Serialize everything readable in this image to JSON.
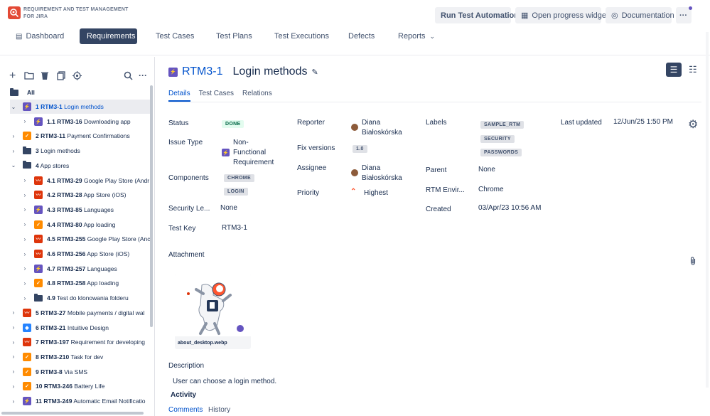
{
  "header": {
    "app_title": "REQUIREMENT AND TEST MANAGEMENT FOR JIRA",
    "run_automation": "Run Test Automation",
    "progress_widget": "Open progress widget",
    "documentation": "Documentation",
    "more": "···"
  },
  "nav": {
    "dashboard": "Dashboard",
    "requirements": "Requirements",
    "test_cases": "Test Cases",
    "test_plans": "Test Plans",
    "test_executions": "Test Executions",
    "defects": "Defects",
    "reports": "Reports"
  },
  "tree": {
    "all": "All",
    "rows": [
      {
        "num": "1",
        "key": "RTM3-1",
        "title": "Login methods",
        "type": "story"
      },
      {
        "num": "1.1",
        "key": "RTM3-16",
        "title": "Downloading app",
        "type": "story"
      },
      {
        "num": "2",
        "key": "RTM3-11",
        "title": "Payment Confirmations",
        "type": "task-orange"
      },
      {
        "num": "3",
        "key": "",
        "title": "Login methods",
        "type": "folder"
      },
      {
        "num": "4",
        "key": "",
        "title": "App stores",
        "type": "folder"
      },
      {
        "num": "4.1",
        "key": "RTM3-29",
        "title": "Google Play Store (Andr",
        "type": "red"
      },
      {
        "num": "4.2",
        "key": "RTM3-28",
        "title": "App Store (iOS)",
        "type": "red"
      },
      {
        "num": "4.3",
        "key": "RTM3-85",
        "title": "Languages",
        "type": "story"
      },
      {
        "num": "4.4",
        "key": "RTM3-80",
        "title": "App loading",
        "type": "task-orange"
      },
      {
        "num": "4.5",
        "key": "RTM3-255",
        "title": "Google Play Store (Anc",
        "type": "red"
      },
      {
        "num": "4.6",
        "key": "RTM3-256",
        "title": "App Store (iOS)",
        "type": "red"
      },
      {
        "num": "4.7",
        "key": "RTM3-257",
        "title": "Languages",
        "type": "story"
      },
      {
        "num": "4.8",
        "key": "RTM3-258",
        "title": "App loading",
        "type": "task-orange"
      },
      {
        "num": "4.9",
        "key": "",
        "title": "Test do klonowania folderu",
        "type": "folder"
      },
      {
        "num": "5",
        "key": "RTM3-27",
        "title": "Mobile payments / digital wal",
        "type": "red"
      },
      {
        "num": "6",
        "key": "RTM3-21",
        "title": "Intuitive Design",
        "type": "blue"
      },
      {
        "num": "7",
        "key": "RTM3-197",
        "title": "Requirement for developing",
        "type": "red"
      },
      {
        "num": "8",
        "key": "RTM3-210",
        "title": "Task for dev",
        "type": "task-orange"
      },
      {
        "num": "9",
        "key": "RTM3-8",
        "title": "Via SMS",
        "type": "task-orange"
      },
      {
        "num": "10",
        "key": "RTM3-246",
        "title": "Battery Life",
        "type": "task-orange"
      },
      {
        "num": "11",
        "key": "RTM3-249",
        "title": "Automatic Email Notificatio",
        "type": "story"
      }
    ]
  },
  "issue": {
    "key": "RTM3-1",
    "title": "Login methods",
    "tabs": {
      "details": "Details",
      "test_cases": "Test Cases",
      "relations": "Relations"
    },
    "fields": {
      "status_label": "Status",
      "status_value": "DONE",
      "issue_type_label": "Issue Type",
      "issue_type_l1": "Non-",
      "issue_type_l2": "Functional",
      "issue_type_l3": "Requirement",
      "components_label": "Components",
      "component_1": "CHROME",
      "component_2": "LOGIN",
      "security_label": "Security Le...",
      "security_value": "None",
      "test_key_label": "Test Key",
      "test_key_value": "RTM3-1",
      "reporter_label": "Reporter",
      "reporter_l1": "Diana",
      "reporter_l2": "Białoskórska",
      "fix_versions_label": "Fix versions",
      "fix_version": "1.0",
      "assignee_label": "Assignee",
      "assignee_l1": "Diana",
      "assignee_l2": "Białoskórska",
      "priority_label": "Priority",
      "priority_value": "Highest",
      "labels_label": "Labels",
      "label_1": "SAMPLE_RTM",
      "label_2": "SECURITY",
      "label_3": "PASSWORDS",
      "parent_label": "Parent",
      "parent_value": "None",
      "rtm_env_label": "RTM Envir...",
      "rtm_env_value": "Chrome",
      "created_label": "Created",
      "created_value": "03/Apr/23 10:56 AM",
      "last_updated_label": "Last updated",
      "last_updated_value": "12/Jun/25 1:50 PM"
    },
    "attachment_label": "Attachment",
    "attachment_file": "about_desktop.webp",
    "description_label": "Description",
    "description_text": "User can choose a login method.",
    "activity_label": "Activity",
    "activity_tabs": {
      "comments": "Comments",
      "history": "History"
    }
  },
  "colors": {
    "accent": "#0052cc",
    "nav_active": "#344563",
    "logo": "#e34935",
    "story": "#6554c0",
    "task_orange": "#ff8b00",
    "red_req": "#de350b",
    "blue_req": "#2684ff"
  }
}
